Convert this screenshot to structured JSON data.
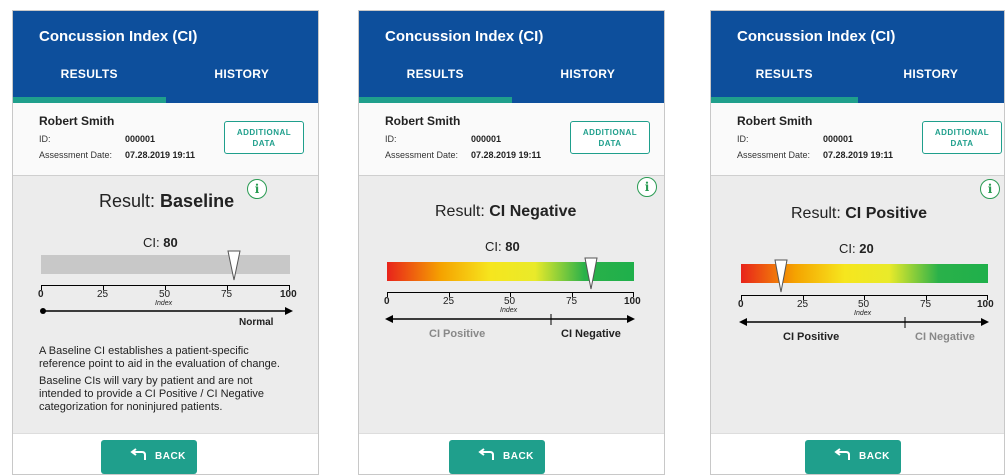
{
  "screens": [
    {
      "app_title": "Concussion Index (CI)",
      "tabs": [
        "RESULTS",
        "HISTORY"
      ],
      "patient": {
        "name": "Robert Smith",
        "id_label": "ID:",
        "id_value": "000001",
        "date_label": "Assessment Date:",
        "date_value": "07.28.2019 19:11"
      },
      "additional_data": [
        "ADDITIONAL",
        "DATA"
      ],
      "info_icon": "i",
      "result_label": "Result:",
      "result_value": "Baseline",
      "ci_label": "CI:",
      "ci_value": "80",
      "scale_ticks": [
        "0",
        "25",
        "50",
        "75",
        "100"
      ],
      "index_label": "Index",
      "category_left": "",
      "category_right": "Normal",
      "description": [
        "A Baseline CI establishes a patient-specific reference point to aid in the evaluation of change.",
        "Baseline CIs will vary by patient and are not intended to provide a CI Positive / CI Negative categorization for noninjured patients."
      ],
      "back_label": "BACK",
      "bar_style": "gray"
    },
    {
      "app_title": "Concussion Index (CI)",
      "tabs": [
        "RESULTS",
        "HISTORY"
      ],
      "patient": {
        "name": "Robert Smith",
        "id_label": "ID:",
        "id_value": "000001",
        "date_label": "Assessment Date:",
        "date_value": "07.28.2019 19:11"
      },
      "additional_data": [
        "ADDITIONAL",
        "DATA"
      ],
      "info_icon": "i",
      "result_label": "Result:",
      "result_value": "CI Negative",
      "ci_label": "CI:",
      "ci_value": "80",
      "scale_ticks": [
        "0",
        "25",
        "50",
        "75",
        "100"
      ],
      "index_label": "Index",
      "category_left": "CI Positive",
      "category_right": "CI Negative",
      "back_label": "BACK",
      "bar_style": "gradient"
    },
    {
      "app_title": "Concussion Index (CI)",
      "tabs": [
        "RESULTS",
        "HISTORY"
      ],
      "patient": {
        "name": "Robert Smith",
        "id_label": "ID:",
        "id_value": "000001",
        "date_label": "Assessment Date:",
        "date_value": "07.28.2019 19:11"
      },
      "additional_data": [
        "ADDITIONAL",
        "DATA"
      ],
      "info_icon": "i",
      "result_label": "Result:",
      "result_value": "CI Positive",
      "ci_label": "CI:",
      "ci_value": "20",
      "scale_ticks": [
        "0",
        "25",
        "50",
        "75",
        "100"
      ],
      "index_label": "Index",
      "category_left": "CI Positive",
      "category_right": "CI Negative",
      "back_label": "BACK",
      "bar_style": "gradient"
    }
  ],
  "colors": {
    "appbar": "#0d4f9c",
    "accent": "#1f9f8c",
    "info": "#2a9b53"
  }
}
